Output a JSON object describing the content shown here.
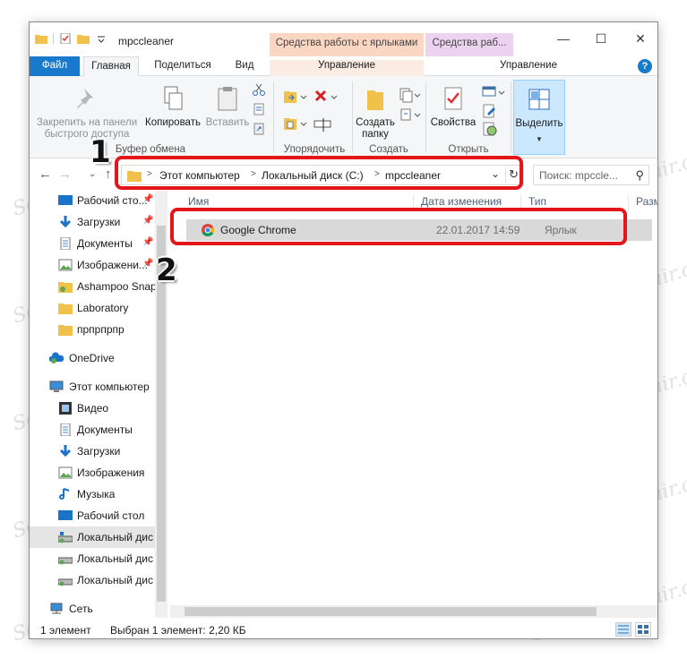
{
  "window": {
    "title": "mpccleaner",
    "context_tab_1": "Средства работы с ярлыками",
    "context_tab_2": "Средства раб...",
    "min": "—",
    "max": "☐",
    "close": "✕"
  },
  "tabs": {
    "file": "Файл",
    "home": "Главная",
    "share": "Поделиться",
    "view": "Вид",
    "manage1": "Управление",
    "manage2": "Управление",
    "help": "?"
  },
  "ribbon": {
    "pin_line1": "Закрепить на панели",
    "pin_line2": "быстрого доступа",
    "copy": "Копировать",
    "paste": "Вставить",
    "group_clipboard": "Буфер обмена",
    "group_organize": "Упорядочить",
    "create_folder_line1": "Создать",
    "create_folder_line2": "папку",
    "group_create": "Создать",
    "properties": "Свойства",
    "group_open": "Открыть",
    "select": "Выделить"
  },
  "address": {
    "crumbs": [
      "Этот компьютер",
      "Локальный диск (C:)",
      "mpccleaner"
    ],
    "search_placeholder": "Поиск: mpccle..."
  },
  "nav_pane": {
    "items": [
      {
        "label": "Рабочий сто...",
        "icon": "desktop-icon"
      },
      {
        "label": "Загрузки",
        "icon": "downloads-icon"
      },
      {
        "label": "Документы",
        "icon": "documents-icon"
      },
      {
        "label": "Изображени...",
        "icon": "pictures-icon"
      },
      {
        "label": "Ashampoo Snap",
        "icon": "folder-icon"
      },
      {
        "label": "Laboratory",
        "icon": "folder-icon"
      },
      {
        "label": "прпрпрпр",
        "icon": "folder-icon"
      },
      {
        "label": "OneDrive",
        "icon": "onedrive-icon"
      },
      {
        "label": "Этот компьютер",
        "icon": "computer-icon"
      },
      {
        "label": "Видео",
        "icon": "video-icon"
      },
      {
        "label": "Документы",
        "icon": "documents-icon"
      },
      {
        "label": "Загрузки",
        "icon": "downloads-icon"
      },
      {
        "label": "Изображения",
        "icon": "pictures-icon"
      },
      {
        "label": "Музыка",
        "icon": "music-icon"
      },
      {
        "label": "Рабочий стол",
        "icon": "desktop-icon"
      },
      {
        "label": "Локальный дис",
        "icon": "drive-icon"
      },
      {
        "label": "Локальный дис",
        "icon": "drive-icon"
      },
      {
        "label": "Локальный дис",
        "icon": "drive-icon"
      },
      {
        "label": "Сеть",
        "icon": "network-icon"
      }
    ]
  },
  "columns": {
    "name": "Имя",
    "date": "Дата изменения",
    "type": "Тип",
    "size": "Разм"
  },
  "files": [
    {
      "name": "Google Chrome",
      "date": "22.01.2017 14:59",
      "type": "Ярлык"
    }
  ],
  "status": {
    "count": "1 элемент",
    "selected": "Выбран 1 элемент: 2,20 КБ"
  },
  "annotations": {
    "marker_1": "1",
    "marker_2": "2",
    "highlight_color": "#e4161b"
  },
  "watermark": "Soringpcrepair.com",
  "colors": {
    "file_tab": "#1979ca",
    "context_shortcut": "#fbd7c3",
    "context_other": "#ecd3f0",
    "selection": "#cce8ff"
  }
}
